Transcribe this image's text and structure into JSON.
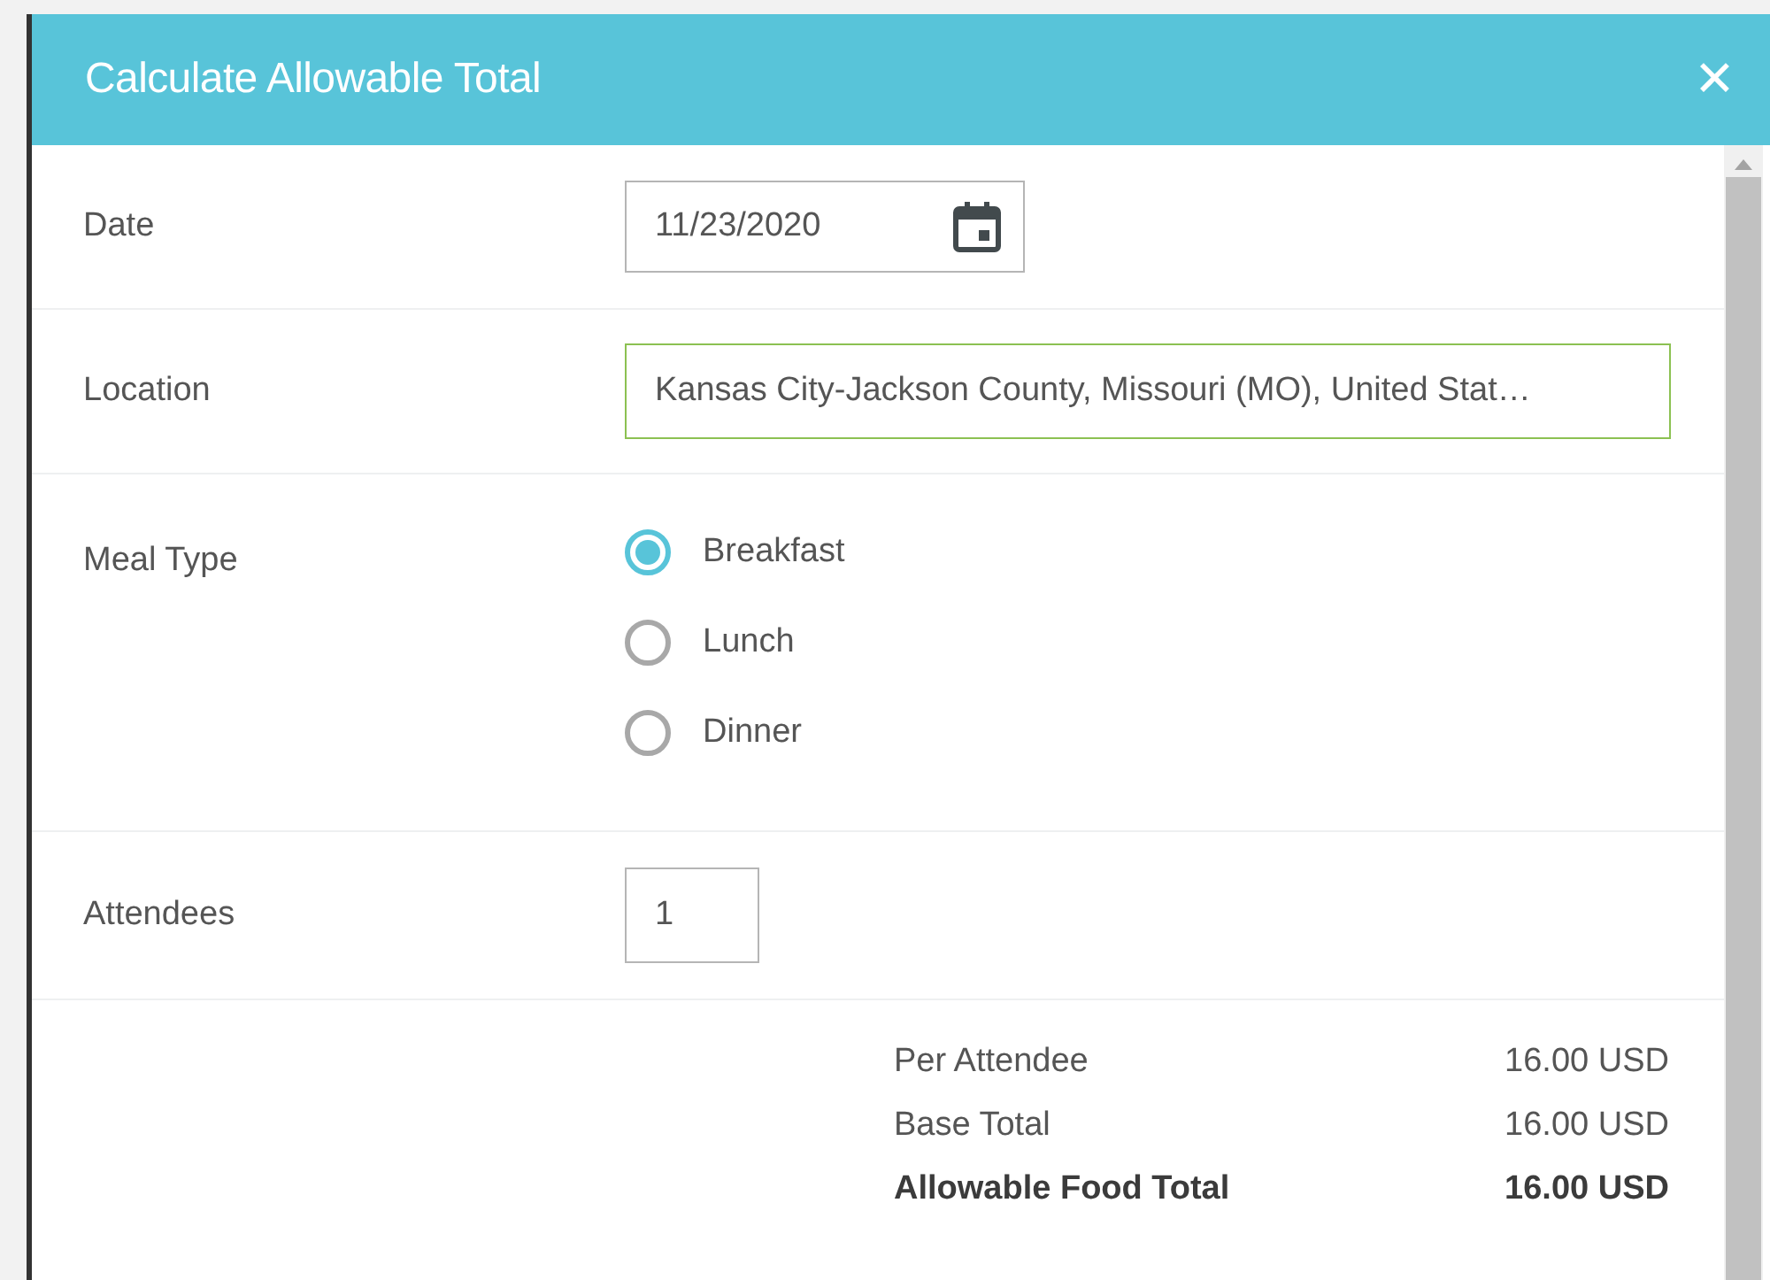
{
  "dialog": {
    "title": "Calculate Allowable Total",
    "close": "✕"
  },
  "fields": [
    {
      "kind": "date",
      "label": "Date",
      "value": "11/23/2020"
    },
    {
      "kind": "text",
      "label": "Location",
      "value": "Kansas City-Jackson County, Missouri (MO), United Stat…"
    },
    {
      "kind": "radio",
      "label": "Meal Type",
      "options": [
        {
          "label": "Breakfast",
          "selected": true
        },
        {
          "label": "Lunch",
          "selected": false
        },
        {
          "label": "Dinner",
          "selected": false
        }
      ]
    },
    {
      "kind": "number",
      "label": "Attendees",
      "value": "1"
    }
  ],
  "totals": [
    {
      "label": "Per Attendee",
      "value": "16.00 USD",
      "bold": false
    },
    {
      "label": "Base Total",
      "value": "16.00 USD",
      "bold": false
    },
    {
      "label": "Allowable Food Total",
      "value": "16.00 USD",
      "bold": true
    }
  ]
}
